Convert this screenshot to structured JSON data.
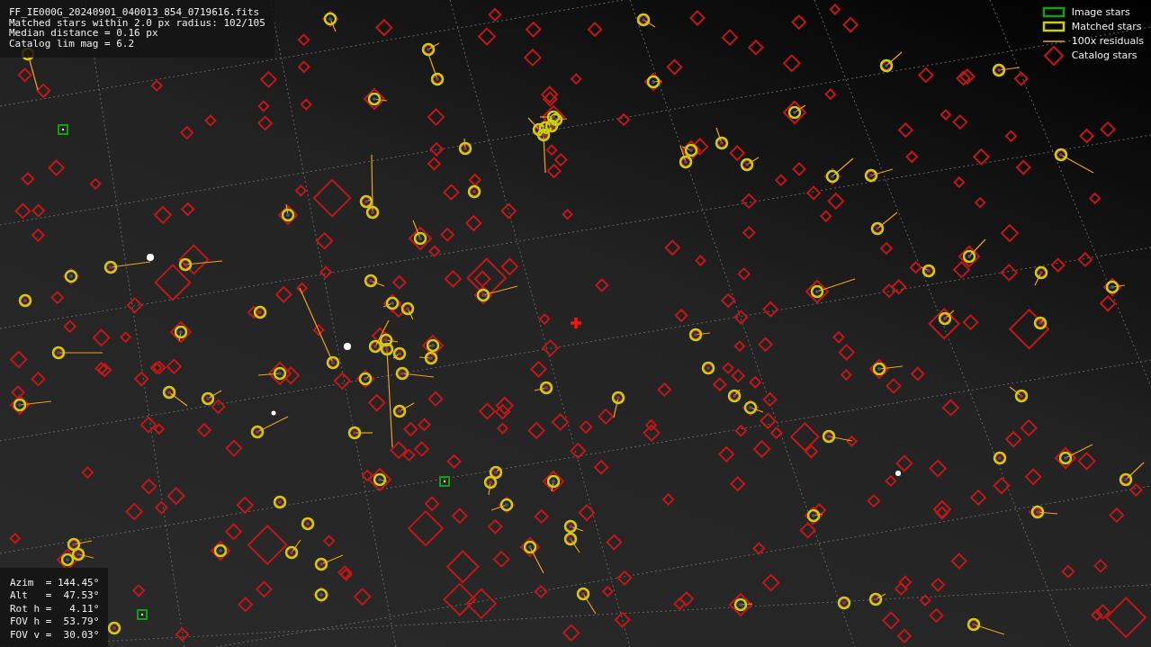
{
  "info": {
    "lines": [
      "FF_IE000G_20240901_040013_854_0719616.fits",
      "Matched stars within 2.0 px radius: 102/105",
      "Median distance = 0.16 px",
      "Catalog lim mag = 6.2"
    ]
  },
  "legend": [
    {
      "kind": "image",
      "label": "Image stars"
    },
    {
      "kind": "matched",
      "label": "Matched stars"
    },
    {
      "kind": "residual",
      "label": "100x residuals"
    },
    {
      "kind": "catalog",
      "label": "Catalog stars"
    }
  ],
  "pointing": {
    "lines": [
      "Azim  = 144.45°",
      "Alt   =  47.53°",
      "Rot h =   4.11°",
      "FOV h =  53.79°",
      "FOV v =  30.03°"
    ]
  }
}
